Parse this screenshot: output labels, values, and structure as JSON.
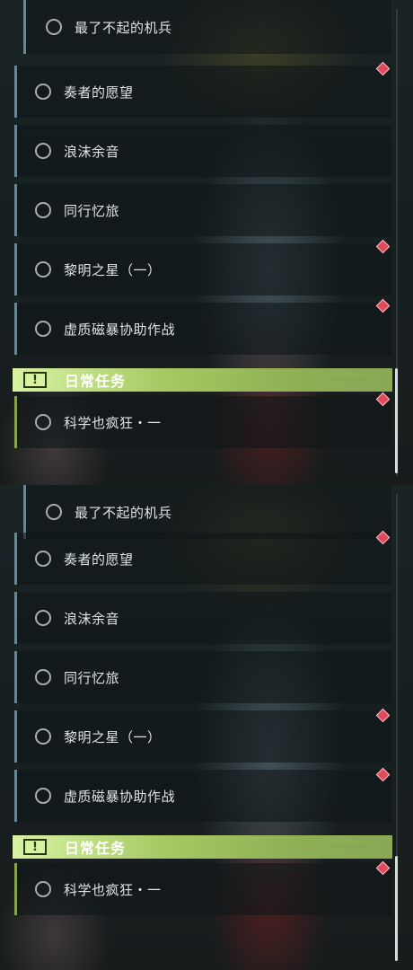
{
  "quests": [
    {
      "label": "最了不起的机兵"
    },
    {
      "label": "奏者的愿望"
    },
    {
      "label": "浪沫余音"
    },
    {
      "label": "同行忆旅"
    },
    {
      "label": "黎明之星（一）"
    },
    {
      "label": "虚质磁暴协助作战"
    }
  ],
  "daily_section": {
    "title": "日常任务",
    "icon": "exclamation-icon",
    "items": [
      {
        "label": "科学也疯狂・一"
      }
    ]
  },
  "colors": {
    "accent_green": "#a6c963",
    "row_border_blue": "#6a8793",
    "row_border_green": "#87a34b",
    "marker_red": "#e04a5a"
  }
}
